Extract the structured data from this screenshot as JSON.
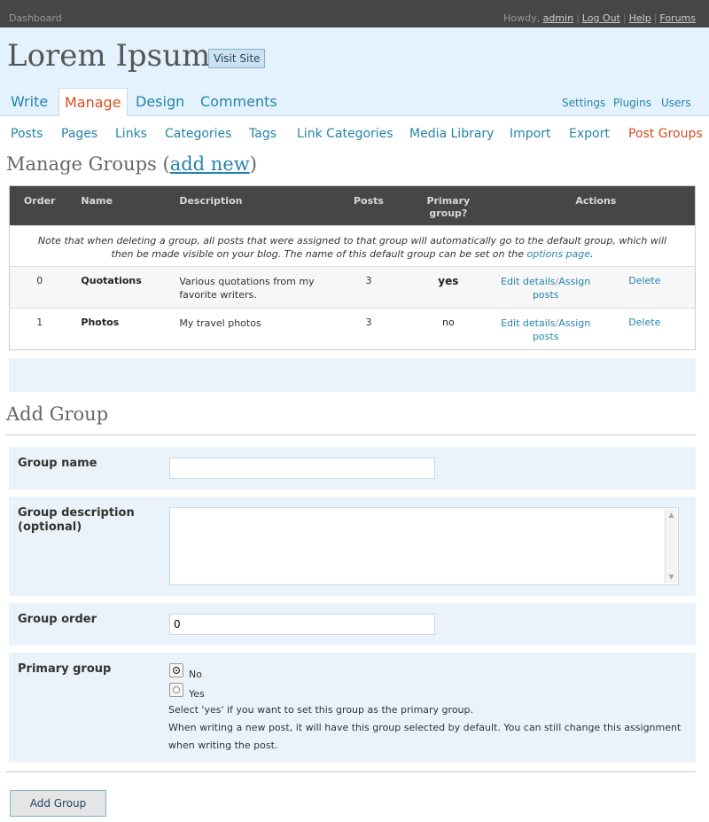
{
  "topbar": {
    "dashboard": "Dashboard",
    "howdy": "Howdy,",
    "user": "admin",
    "logout": "Log Out",
    "help": "Help",
    "forums": "Forums"
  },
  "header": {
    "blog_title": "Lorem Ipsum",
    "visit_site": "Visit Site"
  },
  "main_tabs": [
    {
      "label": "Write"
    },
    {
      "label": "Manage"
    },
    {
      "label": "Design"
    },
    {
      "label": "Comments"
    }
  ],
  "side_links": [
    {
      "label": "Settings"
    },
    {
      "label": "Plugins"
    },
    {
      "label": "Users"
    }
  ],
  "submenu": [
    {
      "label": "Posts"
    },
    {
      "label": "Pages"
    },
    {
      "label": "Links"
    },
    {
      "label": "Categories"
    },
    {
      "label": "Tags"
    },
    {
      "label": "Link Categories"
    },
    {
      "label": "Media Library"
    },
    {
      "label": "Import"
    },
    {
      "label": "Export"
    },
    {
      "label": "Post Groups"
    }
  ],
  "manage": {
    "title_prefix": "Manage Groups (",
    "add_new": "add new",
    "title_suffix": ")"
  },
  "table": {
    "headers": {
      "order": "Order",
      "name": "Name",
      "description": "Description",
      "posts": "Posts",
      "primary_line1": "Primary",
      "primary_line2": "group?",
      "actions": "Actions"
    },
    "note_text": "Note that when deleting a group, all posts that were assigned to that group will automatically go to the default group, which will then be made visible on your blog. The name of this default group can be set on the",
    "note_link": "options page",
    "note_end": ".",
    "rows": [
      {
        "order": "0",
        "name": "Quotations",
        "description": "Various quotations from my favorite writers.",
        "posts": "3",
        "primary": "yes",
        "edit": "Edit details",
        "assign": "Assign posts",
        "delete": "Delete"
      },
      {
        "order": "1",
        "name": "Photos",
        "description": "My travel photos",
        "posts": "3",
        "primary": "no",
        "edit": "Edit details",
        "assign": "Assign posts",
        "delete": "Delete"
      }
    ]
  },
  "add_group": {
    "title": "Add Group",
    "name_label": "Group name",
    "name_value": "",
    "desc_label_line1": "Group description",
    "desc_label_line2": "(optional)",
    "order_label": "Group order",
    "order_value": "0",
    "primary_label": "Primary group",
    "radio_no": "No",
    "radio_yes": "Yes",
    "radio_selected": "No",
    "help1": "Select 'yes' if you want to set this group as the primary group.",
    "help2": "When writing a new post, it will have this group selected by default. You can still change this assignment when writing the post.",
    "submit": "Add Group"
  },
  "colors": {
    "topbar": "#464646",
    "header_bg": "#e4f2fd",
    "link": "#2583ad",
    "active": "#d54e21",
    "form_row_bg": "#eaf3fa"
  }
}
